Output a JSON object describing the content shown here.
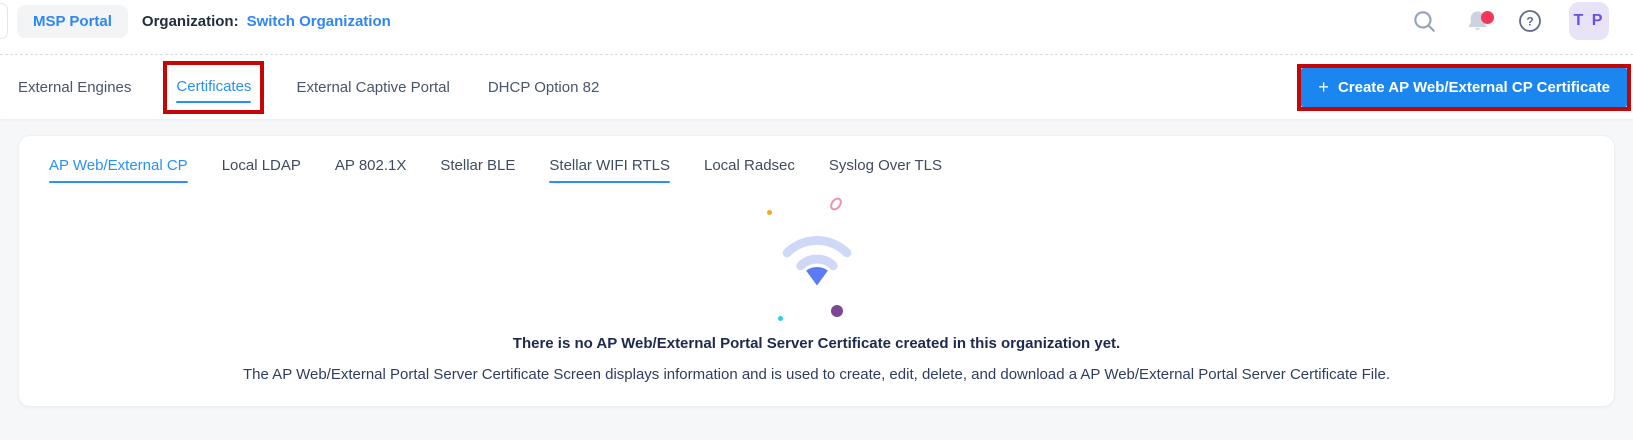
{
  "header": {
    "msp_portal_label": "MSP Portal",
    "organization_label": "Organization:",
    "organization_link": "Switch Organization",
    "avatar_initials": "T P",
    "icons": {
      "search": "magnifier",
      "notifications": "bell-with-red-badge",
      "help": "question-circle"
    }
  },
  "main_tabs": {
    "items": [
      {
        "label": "External Engines",
        "active": false,
        "annotated": false
      },
      {
        "label": "Certificates",
        "active": true,
        "annotated": true
      },
      {
        "label": "External Captive Portal",
        "active": false,
        "annotated": false
      },
      {
        "label": "DHCP Option 82",
        "active": false,
        "annotated": false
      }
    ]
  },
  "create_button": {
    "plus": "+",
    "label": "Create AP Web/External CP Certificate",
    "annotated": true
  },
  "card": {
    "tabs": [
      {
        "label": "AP Web/External CP",
        "active": true
      },
      {
        "label": "Local LDAP",
        "active": false
      },
      {
        "label": "AP 802.1X",
        "active": false
      },
      {
        "label": "Stellar BLE",
        "active": false
      },
      {
        "label": "Stellar WIFI RTLS",
        "active": false,
        "underlined": true
      },
      {
        "label": "Local Radsec",
        "active": false
      },
      {
        "label": "Syslog Over TLS",
        "active": false
      }
    ],
    "empty_state": {
      "icon": "wifi-icon",
      "title": "There is no AP Web/External Portal Server Certificate created in this organization yet.",
      "description": "The AP Web/External Portal Server Certificate Screen displays information and is used to create, edit, delete, and download a AP Web/External Portal Server Certificate File."
    }
  },
  "colors": {
    "accent_blue": "#2790f8",
    "button_blue": "#1b86ef",
    "annotation_red": "#c40606",
    "page_background": "#f6f7f9",
    "badge_red": "#f5365c",
    "avatar_bg": "#e8e3f7",
    "avatar_text": "#6d4ce0",
    "wifi_light": "#cfd9f7",
    "wifi_dark": "#5b7bf2",
    "dot_orange": "#f5a623",
    "dot_purple": "#7e4796",
    "dot_cyan": "#27d0e7",
    "dot_pink": "#f090ad"
  }
}
